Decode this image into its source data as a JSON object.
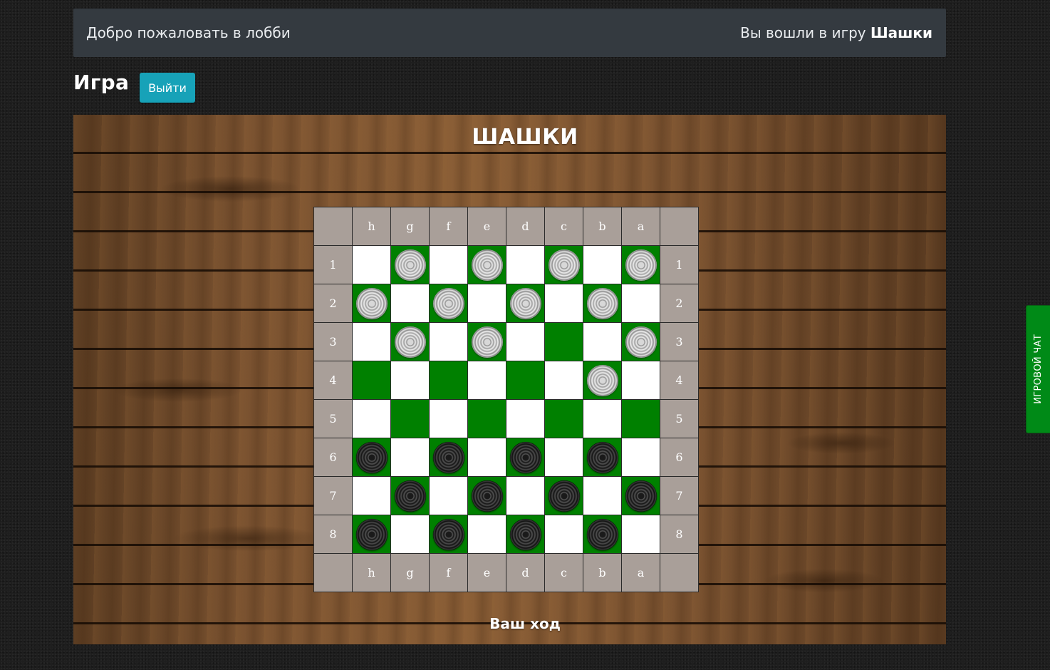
{
  "header": {
    "welcome_text": "Добро пожаловать в лобби",
    "login_prefix": "Вы вошли в игру",
    "game_name": "Шашки"
  },
  "page": {
    "title": "Игра",
    "exit_label": "Выйти"
  },
  "board": {
    "heading": "ШАШКИ",
    "columns": [
      "h",
      "g",
      "f",
      "e",
      "d",
      "c",
      "b",
      "a"
    ],
    "rows": [
      "1",
      "2",
      "3",
      "4",
      "5",
      "6",
      "7",
      "8"
    ],
    "cells": [
      [
        "L",
        "DW",
        "L",
        "DW",
        "L",
        "DW",
        "L",
        "DW"
      ],
      [
        "DW",
        "L",
        "DW",
        "L",
        "DW",
        "L",
        "DW",
        "L"
      ],
      [
        "L",
        "DW",
        "L",
        "DW",
        "L",
        "D",
        "L",
        "DW"
      ],
      [
        "D",
        "L",
        "D",
        "L",
        "D",
        "L",
        "DW",
        "L"
      ],
      [
        "L",
        "D",
        "L",
        "D",
        "L",
        "D",
        "L",
        "D"
      ],
      [
        "DB",
        "L",
        "DB",
        "L",
        "DB",
        "L",
        "DB",
        "L"
      ],
      [
        "L",
        "DB",
        "L",
        "DB",
        "L",
        "DB",
        "L",
        "DB"
      ],
      [
        "DB",
        "L",
        "DB",
        "L",
        "DB",
        "L",
        "DB",
        "L"
      ]
    ],
    "turn_status": "Ваш ход"
  },
  "chat": {
    "label": "ИГРОВОЙ ЧАТ"
  },
  "colors": {
    "dark_square": "#008000",
    "light_square": "#ffffff",
    "label_cell": "#a99f99",
    "exit_button": "#17a2b8",
    "chat_tab": "#008a17",
    "topbar": "#343a40"
  }
}
